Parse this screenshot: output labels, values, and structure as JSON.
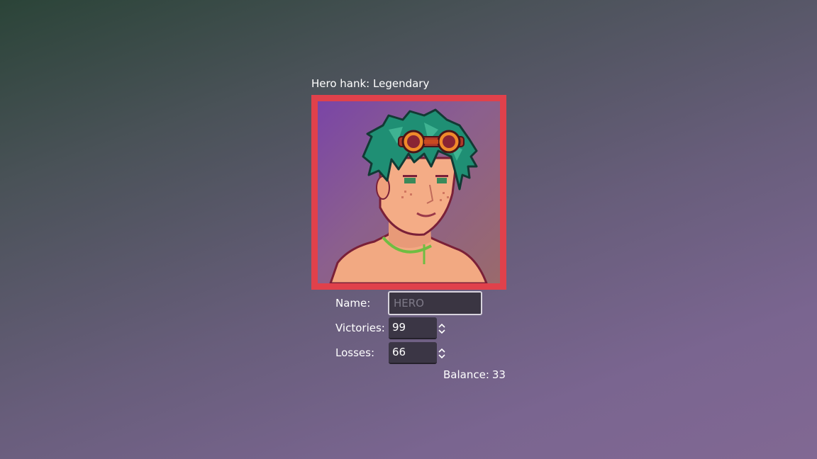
{
  "title": "Hero hank: Legendary",
  "form": {
    "name_label": "Name:",
    "name_value": "",
    "name_placeholder": "HERO",
    "victories_label": "Victories:",
    "victories_value": "99",
    "losses_label": "Losses:",
    "losses_value": "66"
  },
  "balance": {
    "label": "Balance:",
    "value": "33"
  },
  "colors": {
    "frame_border": "#e0414b",
    "hair": "#1f8f74",
    "skin": "#f2a982",
    "goggles": "#e0621c"
  },
  "icons": {
    "spin_arrows": "chevron-up-down-icon"
  }
}
